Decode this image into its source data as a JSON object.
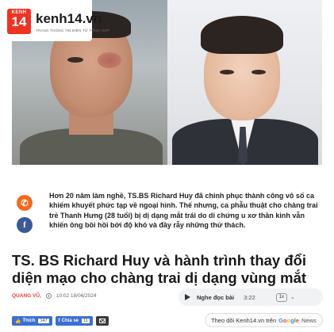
{
  "brand": {
    "badge_top": "KENH",
    "badge_number": "14",
    "name": "kenh14.vn",
    "tagline": "TRANG THÔNG TIN ĐIỆN TỬ TỔNG HỢP",
    "accent_color": "#ee3322"
  },
  "article": {
    "sapo": "Hơn 20 năm làm nghề, TS.BS Richard Huy đã chinh phục thành công vô số ca khiếm khuyết phức tạp về ngoại hình. Thế nhưng, ca phẫu thuật cho chàng trai trẻ Thanh Hưng (28 tuổi) bị dị dạng mắt trái do di chứng u xơ thần kinh vẫn khiến ông bồi hồi bởi độ khó và đầy rẫy những thử thách.",
    "title": "TS. BS Richard Huy và hành trình thay đổi diện mạo cho chàng trai dị dạng vùng mắt",
    "author": "QUANG VŨ,",
    "datetime": "10:02 18/06/2024"
  },
  "share_side": {
    "zalo_icon": "zalo-icon",
    "facebook_icon": "facebook-icon",
    "facebook_letter": "f"
  },
  "player": {
    "label": "Nghe đọc bài",
    "duration": "3:22",
    "speed": "1x",
    "chevron": "⌄"
  },
  "bottom": {
    "like_label": "Thích",
    "like_count": "147",
    "share_label": "Chia sẻ",
    "share_count": "11",
    "follow_prefix": "Theo dõi Kenh14.vn trên",
    "google_g": "G",
    "google_o1": "o",
    "google_o2": "o",
    "google_g2": "g",
    "google_l": "l",
    "google_e": "e",
    "google_news": "News"
  }
}
